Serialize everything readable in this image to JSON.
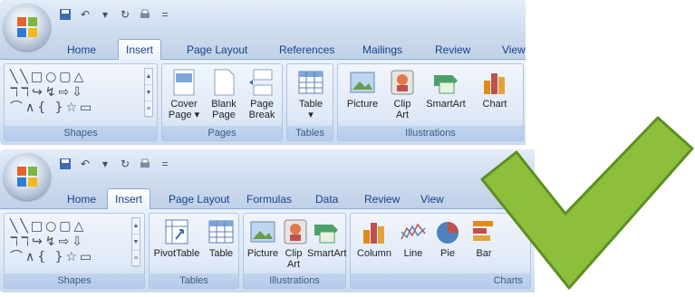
{
  "ribbon_top": {
    "tabs": [
      "Home",
      "Insert",
      "Page Layout",
      "References",
      "Mailings",
      "Review",
      "View"
    ],
    "active_tab": "Insert",
    "groups": {
      "shapes": "Shapes",
      "pages": "Pages",
      "tables": "Tables",
      "illustrations": "Illustrations"
    },
    "buttons": {
      "cover_page_1": "Cover",
      "cover_page_2": "Page ▾",
      "blank_page_1": "Blank",
      "blank_page_2": "Page",
      "page_break_1": "Page",
      "page_break_2": "Break",
      "table_1": "Table",
      "table_2": "▾",
      "picture": "Picture",
      "clip_art_1": "Clip",
      "clip_art_2": "Art",
      "smartart": "SmartArt",
      "chart": "Chart"
    }
  },
  "ribbon_bottom": {
    "tabs": [
      "Home",
      "Insert",
      "Page Layout",
      "Formulas",
      "Data",
      "Review",
      "View"
    ],
    "active_tab": "Insert",
    "groups": {
      "shapes": "Shapes",
      "tables": "Tables",
      "illustrations": "Illustrations",
      "charts": "Charts"
    },
    "buttons": {
      "pivottable": "PivotTable",
      "table": "Table",
      "picture": "Picture",
      "clip_art_1": "Clip",
      "clip_art_2": "Art",
      "smartart": "SmartArt",
      "column": "Column",
      "line": "Line",
      "pie": "Pie",
      "bar": "Bar"
    }
  },
  "colors": {
    "ribbon_text": "#15428b",
    "checkmark": "#8bbf3c"
  }
}
